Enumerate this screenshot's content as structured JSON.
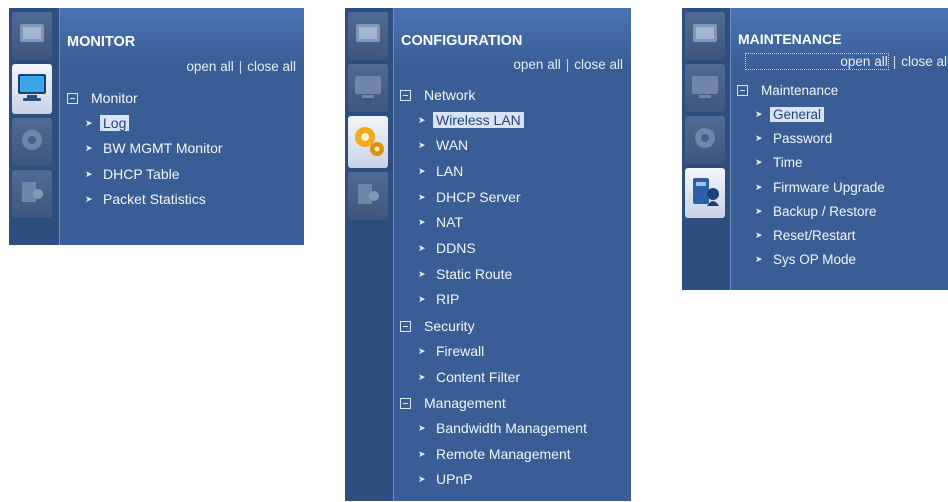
{
  "monitor": {
    "title": "MONITOR",
    "open_all": "open all",
    "sep": "|",
    "close_all": "close all",
    "group": "Monitor",
    "items": [
      "Log",
      "BW MGMT Monitor",
      "DHCP Table",
      "Packet Statistics"
    ]
  },
  "configuration": {
    "title": "CONFIGURATION",
    "open_all": "open all",
    "sep": "|",
    "close_all": "close all",
    "groups": [
      {
        "label": "Network",
        "items": [
          "Wireless LAN",
          "WAN",
          "LAN",
          "DHCP Server",
          "NAT",
          "DDNS",
          "Static Route",
          "RIP"
        ]
      },
      {
        "label": "Security",
        "items": [
          "Firewall",
          "Content Filter"
        ]
      },
      {
        "label": "Management",
        "items": [
          "Bandwidth Management",
          "Remote Management",
          "UPnP"
        ]
      }
    ]
  },
  "maintenance": {
    "title": "MAINTENANCE",
    "open_all": "open all",
    "sep": "|",
    "close_all": "close all",
    "group": "Maintenance",
    "items": [
      "General",
      "Password",
      "Time",
      "Firmware Upgrade",
      "Backup / Restore",
      "Reset/Restart",
      "Sys OP Mode"
    ]
  },
  "icons": {
    "expand": "collapse-box-icon",
    "item": "arrow-right-icon",
    "tabs": [
      "monitor-tab-icon",
      "configuration-tab-icon",
      "maintenance-tab-icon",
      "status-tab-icon"
    ]
  },
  "colors": {
    "panel": "#3b5d96",
    "highlight": "#d9e3f4",
    "text": "#f2f5fb"
  }
}
